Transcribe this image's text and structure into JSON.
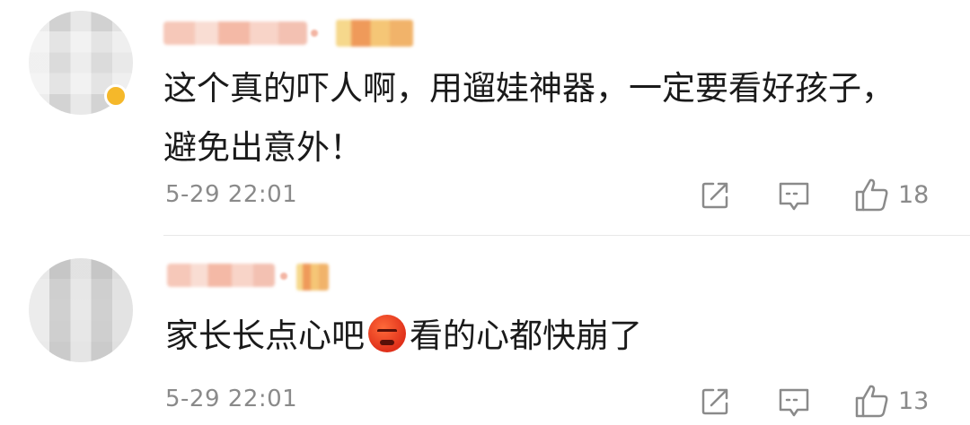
{
  "comments": [
    {
      "content": "这个真的吓人啊，用遛娃神器，一定要看好孩子，避免出意外！",
      "timestamp": "5-29 22:01",
      "likes": "18",
      "verified": true
    },
    {
      "content_before": "家长长点心吧",
      "emoji": "angry-face-emoji",
      "content_after": "看的心都快崩了",
      "timestamp": "5-29 22:01",
      "likes": "13",
      "verified": false
    }
  ],
  "icons": {
    "share": "share-icon",
    "reply": "comment-icon",
    "like": "thumbs-up-icon"
  },
  "colors": {
    "text": "#1a1a1a",
    "meta": "#8a8a8a",
    "badge": "#f5b82a"
  }
}
